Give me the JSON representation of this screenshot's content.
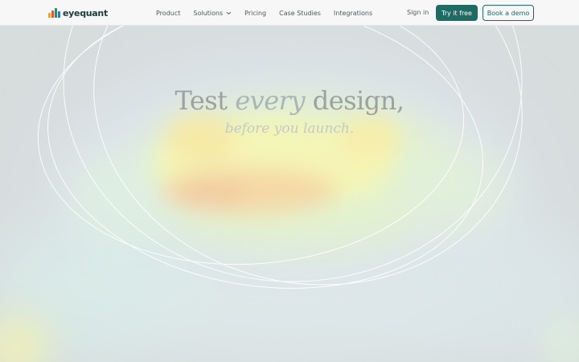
{
  "brand": {
    "name": "eyequant",
    "logo_bar_colors": [
      "#e9a23b",
      "#d9583a",
      "#2e8a6a",
      "#3b6fb6"
    ]
  },
  "nav": {
    "links": [
      "Product",
      "Solutions",
      "Pricing",
      "Case Studies",
      "Integrations"
    ],
    "dropdown_link": "Solutions",
    "sign_in": "Sign in",
    "cta_primary": "Try it free",
    "cta_secondary": "Book a demo"
  },
  "hero": {
    "headline_part1": "Test ",
    "headline_emphasis": "every",
    "headline_part2": " design,",
    "subheadline": "before you launch."
  },
  "colors": {
    "accent": "#1f6b63",
    "nav_background": "#f6f7f6",
    "hero_background": "#d7dcdd"
  }
}
